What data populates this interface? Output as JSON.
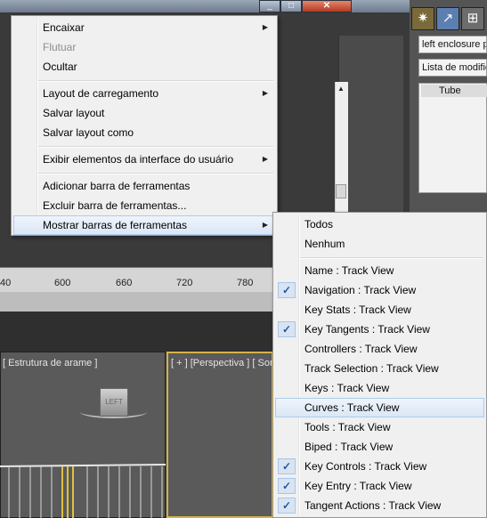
{
  "window": {
    "minimize": "_",
    "maximize": "□",
    "close": "✕"
  },
  "command_panel": {
    "object_name": "left enclosure p",
    "modifier_list": "Lista de modific",
    "stack_item": "Tube"
  },
  "timeline": {
    "ticks": [
      "40",
      "600",
      "660",
      "720",
      "780"
    ]
  },
  "viewports": {
    "left_label": "[ Estrutura de arame ]",
    "right_label": "[ + ] [Perspectiva ] [ Som",
    "cube_label": "LEFT",
    "cube_label_top": "LEFT"
  },
  "context_menu": {
    "items": [
      {
        "label": "Encaixar",
        "submenu": true,
        "enabled": true
      },
      {
        "label": "Flutuar",
        "submenu": false,
        "enabled": false
      },
      {
        "label": "Ocultar",
        "submenu": false,
        "enabled": true
      },
      {
        "label": "Layout de carregamento",
        "submenu": true,
        "enabled": true
      },
      {
        "label": "Salvar layout",
        "submenu": false,
        "enabled": true
      },
      {
        "label": "Salvar layout como",
        "submenu": false,
        "enabled": true
      },
      {
        "label": "Exibir elementos da interface do usuário",
        "submenu": true,
        "enabled": true
      },
      {
        "label": "Adicionar barra de ferramentas",
        "submenu": false,
        "enabled": true
      },
      {
        "label": "Excluir barra de ferramentas...",
        "submenu": false,
        "enabled": true
      },
      {
        "label": "Mostrar barras de ferramentas",
        "submenu": true,
        "enabled": true,
        "highlighted": true
      }
    ]
  },
  "submenu": {
    "items": [
      {
        "label": "Todos",
        "checked": false
      },
      {
        "label": "Nenhum",
        "checked": false
      },
      {
        "label": "Name : Track View",
        "checked": false
      },
      {
        "label": "Navigation : Track View",
        "checked": true
      },
      {
        "label": "Key Stats : Track View",
        "checked": false
      },
      {
        "label": "Key Tangents : Track View",
        "checked": true
      },
      {
        "label": "Controllers : Track View",
        "checked": false
      },
      {
        "label": "Track Selection : Track View",
        "checked": false
      },
      {
        "label": "Keys : Track View",
        "checked": false
      },
      {
        "label": "Curves : Track View",
        "checked": false,
        "highlighted": true
      },
      {
        "label": "Tools : Track View",
        "checked": false
      },
      {
        "label": "Biped : Track View",
        "checked": false
      },
      {
        "label": "Key Controls : Track View",
        "checked": true
      },
      {
        "label": "Key Entry : Track View",
        "checked": true
      },
      {
        "label": "Tangent Actions : Track View",
        "checked": true
      }
    ],
    "check_glyph": "✓"
  },
  "colors": {
    "highlight": "#dbe7f5",
    "check": "#2456a8",
    "viewport_active_border": "#d4b14a"
  }
}
